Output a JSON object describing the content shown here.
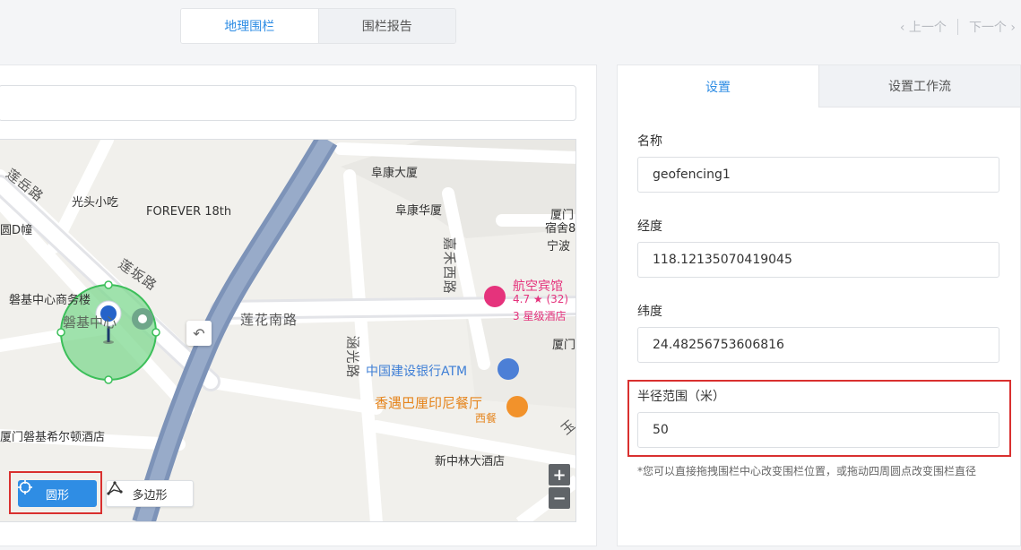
{
  "top_tabs": {
    "geofence": "地理围栏",
    "report": "围栏报告"
  },
  "pager": {
    "prev": "‹ 上一个",
    "next": "下一个 ›"
  },
  "map": {
    "labels": {
      "fukang_building": "阜康大厦",
      "fukang_huayuan": "阜康华厦",
      "guangtou": "光头小吃",
      "forever": "FOREVER 18th",
      "lianyue_road": "莲岳路",
      "xiamen_top": "厦门",
      "susheb": "宿舍8",
      "ningbo": "宁波",
      "jipan": "圆D幢",
      "panji_business": "磐基中心商务楼",
      "panji_center": "磐基中心",
      "lianban_road": "莲坂路",
      "lianhua_south": "莲花南路",
      "jiahe_west": "嘉禾西路",
      "hangkong_hotel": "航空宾馆",
      "hotel_rating": "4.7 ★ (32)",
      "hotel_class": "3 星级酒店",
      "xiamen_mid": "厦门",
      "hanguang": "涵光路",
      "ccb_atm": "中国建设银行ATM",
      "bali_restaurant": "香遇巴厘印尼餐厅",
      "western": "西餐",
      "hilton": "厦门磐基希尔顿酒店",
      "xinzhonglin": "新中林大酒店",
      "yu_road": "玉"
    },
    "zoom_in": "+",
    "zoom_out": "−",
    "undo_icon": "undo-arrow"
  },
  "shape_buttons": {
    "circle": "圆形",
    "polygon": "多边形"
  },
  "settings": {
    "tabs": {
      "settings": "设置",
      "workflow": "设置工作流"
    },
    "name_label": "名称",
    "name_value": "geofencing1",
    "longitude_label": "经度",
    "longitude_value": "118.12135070419045",
    "latitude_label": "纬度",
    "latitude_value": "24.48256753606816",
    "radius_label": "半径范围（米）",
    "radius_value": "50",
    "hint": "*您可以直接拖拽围栏中心改变围栏位置，或拖动四周圆点改变围栏直径"
  },
  "colors": {
    "accent": "#2f8de4",
    "highlight": "#d9302f",
    "fence_fill": "#7fd890",
    "fence_stroke": "#3cbf5a"
  }
}
